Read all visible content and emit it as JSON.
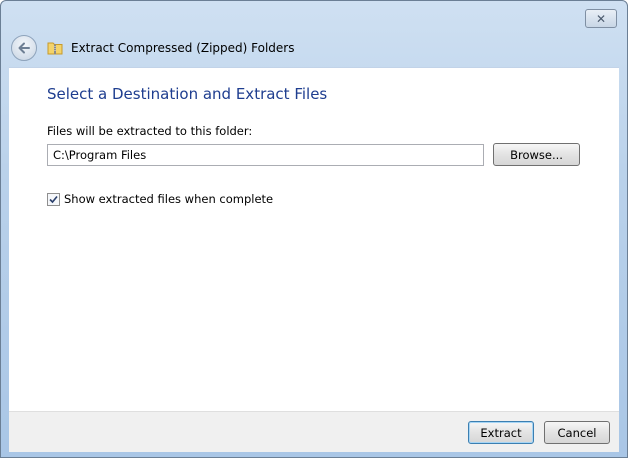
{
  "window": {
    "close_label": "✕"
  },
  "header": {
    "title": "Extract Compressed (Zipped) Folders"
  },
  "main": {
    "heading": "Select a Destination and Extract Files",
    "destination_label": "Files will be extracted to this folder:",
    "path_value": "C:\\Program Files",
    "browse_label": "Browse...",
    "show_files_label": "Show extracted files when complete",
    "show_files_checked": true
  },
  "footer": {
    "extract_label": "Extract",
    "cancel_label": "Cancel"
  },
  "colors": {
    "heading": "#1e3d8f",
    "accent": "#3c7fb1",
    "window_frame": "#b9d1ea"
  },
  "icons": {
    "back": "back-arrow-icon",
    "folder": "zip-folder-icon",
    "close": "close-icon",
    "check": "checkmark-icon"
  }
}
